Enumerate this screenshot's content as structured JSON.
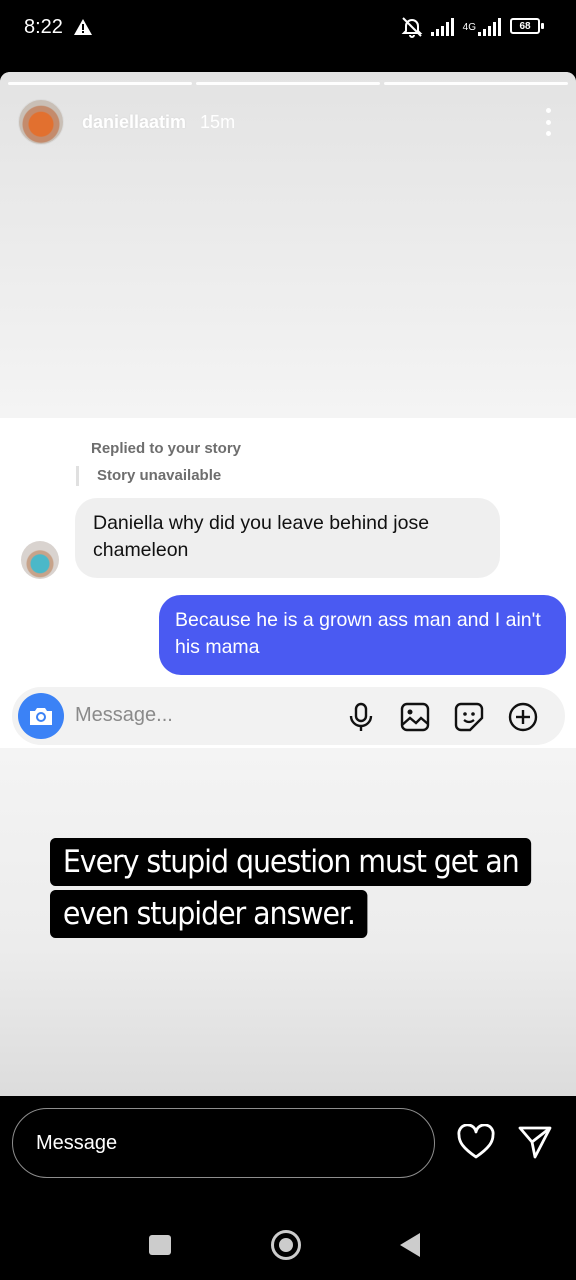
{
  "status_bar": {
    "time": "8:22",
    "network": "4G",
    "battery": "68"
  },
  "story": {
    "username": "daniellaatim",
    "time_ago": "15m",
    "progress_segments": 3,
    "dm": {
      "reply_label": "Replied to your story",
      "story_unavailable": "Story unavailable",
      "incoming_message": "Daniella why did you leave behind jose chameleon",
      "outgoing_message": "Because he is a grown ass man and I ain't his mama",
      "input_placeholder": "Message..."
    },
    "caption_line1": "Every stupid question must get an",
    "caption_line2": "even stupider answer."
  },
  "reply_bar": {
    "placeholder": "Message"
  },
  "colors": {
    "outgoing_bubble": "#4a5af2",
    "camera_button": "#3b82f6"
  },
  "icons": [
    "warning-icon",
    "bell-off-icon",
    "signal-icon",
    "battery-icon",
    "more-icon",
    "camera-icon",
    "mic-icon",
    "image-icon",
    "sticker-icon",
    "plus-icon",
    "heart-icon",
    "send-icon"
  ]
}
